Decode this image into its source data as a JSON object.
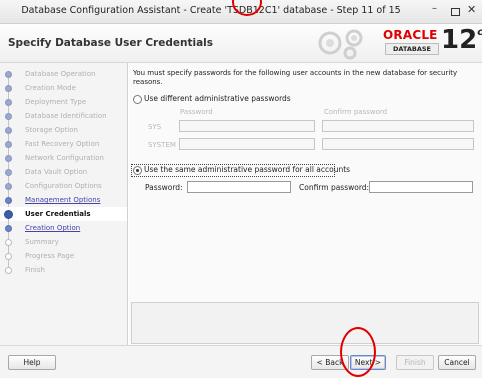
{
  "window": {
    "title": "Database Configuration Assistant - Create 'TSDB12C1' database - Step 11 of 15",
    "min_glyph": "–",
    "close_glyph": "✕"
  },
  "header": {
    "heading": "Specify Database User Credentials",
    "oracle_word": "ORACLE",
    "database_word": "DATABASE",
    "version": "12",
    "version_suffix": "c"
  },
  "sidebar": {
    "steps": [
      {
        "label": "Database Operation",
        "state": "done"
      },
      {
        "label": "Creation Mode",
        "state": "done"
      },
      {
        "label": "Deployment Type",
        "state": "done"
      },
      {
        "label": "Database Identification",
        "state": "done"
      },
      {
        "label": "Storage Option",
        "state": "done"
      },
      {
        "label": "Fast Recovery Option",
        "state": "done"
      },
      {
        "label": "Network Configuration",
        "state": "done"
      },
      {
        "label": "Data Vault Option",
        "state": "done"
      },
      {
        "label": "Configuration Options",
        "state": "done"
      },
      {
        "label": "Management Options",
        "state": "link"
      },
      {
        "label": "User Credentials",
        "state": "active"
      },
      {
        "label": "Creation Option",
        "state": "link"
      },
      {
        "label": "Summary",
        "state": "todo"
      },
      {
        "label": "Progress Page",
        "state": "todo"
      },
      {
        "label": "Finish",
        "state": "todo"
      }
    ]
  },
  "main": {
    "intro": "You must specify passwords for the following user accounts in the new database for security reasons.",
    "option_different": "Use different administrative passwords",
    "col_password": "Password",
    "col_confirm": "Confirm password",
    "row_sys": "SYS",
    "row_system": "SYSTEM",
    "option_same": "Use the same administrative password for all accounts",
    "password_label": "Password:",
    "confirm_label": "Confirm password:"
  },
  "footer": {
    "help": "Help",
    "back": "< Back",
    "next": "Next >",
    "finish": "Finish",
    "cancel": "Cancel"
  },
  "colors": {
    "annotation_circle": "#e00000",
    "oracle_red": "#e00000",
    "link": "#4444aa"
  }
}
